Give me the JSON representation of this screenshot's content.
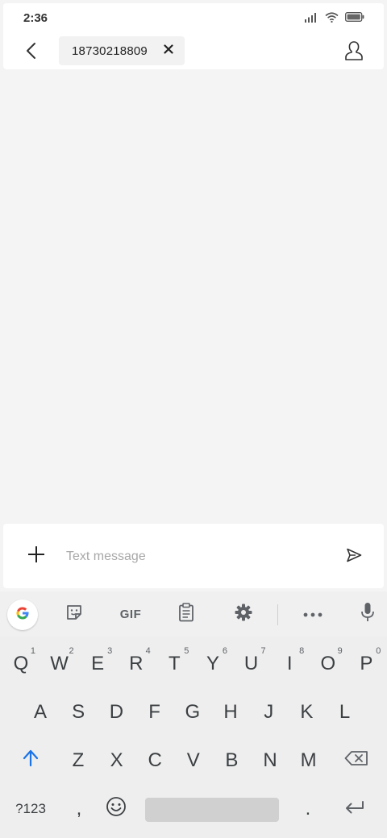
{
  "status_bar": {
    "time": "2:36",
    "icons": [
      "signal-icon",
      "wifi-icon",
      "battery-icon"
    ]
  },
  "header": {
    "recipient_number": "18730218809",
    "icons": [
      "back-arrow-icon",
      "close-icon",
      "contact-icon"
    ]
  },
  "compose": {
    "placeholder": "Text message",
    "value": "",
    "icons": [
      "plus-icon",
      "send-icon"
    ]
  },
  "keyboard": {
    "toolbar": {
      "gif_label": "GIF",
      "icons": [
        "google-icon",
        "sticker-icon",
        "clipboard-icon",
        "settings-icon",
        "more-icon",
        "microphone-icon"
      ]
    },
    "rows": [
      [
        {
          "label": "Q",
          "hint": "1"
        },
        {
          "label": "W",
          "hint": "2"
        },
        {
          "label": "E",
          "hint": "3"
        },
        {
          "label": "R",
          "hint": "4"
        },
        {
          "label": "T",
          "hint": "5"
        },
        {
          "label": "Y",
          "hint": "6"
        },
        {
          "label": "U",
          "hint": "7"
        },
        {
          "label": "I",
          "hint": "8"
        },
        {
          "label": "O",
          "hint": "9"
        },
        {
          "label": "P",
          "hint": "0"
        }
      ],
      [
        {
          "label": "A"
        },
        {
          "label": "S"
        },
        {
          "label": "D"
        },
        {
          "label": "F"
        },
        {
          "label": "G"
        },
        {
          "label": "H"
        },
        {
          "label": "J"
        },
        {
          "label": "K"
        },
        {
          "label": "L"
        }
      ],
      [
        {
          "label": "Z"
        },
        {
          "label": "X"
        },
        {
          "label": "C"
        },
        {
          "label": "V"
        },
        {
          "label": "B"
        },
        {
          "label": "N"
        },
        {
          "label": "M"
        }
      ]
    ],
    "symbols_label": "?123",
    "comma_label": ",",
    "period_label": ".",
    "special_icons": [
      "shift-icon",
      "backspace-icon",
      "emoji-icon",
      "enter-icon"
    ]
  },
  "colors": {
    "accent_shift": "#1a73e8",
    "background": "#f4f4f4",
    "card": "#ffffff",
    "keyboard_bg": "#eeeeee"
  }
}
